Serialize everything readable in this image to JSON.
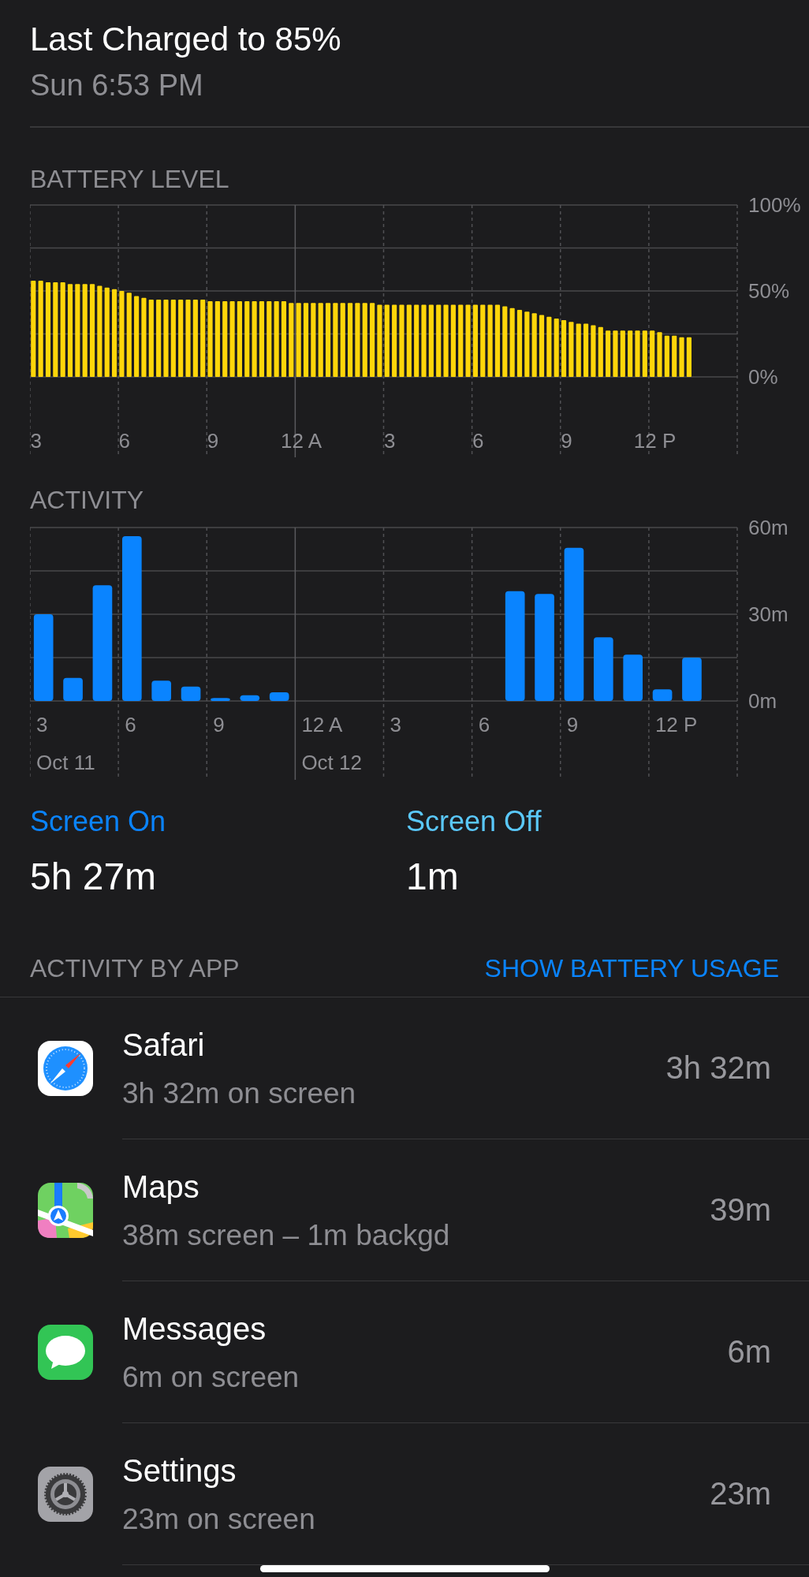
{
  "header": {
    "title": "Last Charged to 85%",
    "subtitle": "Sun 6:53 PM"
  },
  "charts": [
    {
      "chart_data": {
        "type": "bar",
        "title": "BATTERY LEVEL",
        "ylim": [
          0,
          100
        ],
        "grid": true,
        "categories": [
          "3",
          null,
          null,
          null,
          null,
          null,
          null,
          null,
          null,
          null,
          null,
          null,
          "6",
          null,
          null,
          null,
          null,
          null,
          null,
          null,
          null,
          null,
          null,
          null,
          "9",
          null,
          null,
          null,
          null,
          null,
          null,
          null,
          null,
          null,
          null,
          null,
          "12 A",
          null,
          null,
          null,
          null,
          null,
          null,
          null,
          null,
          null,
          null,
          null,
          "3",
          null,
          null,
          null,
          null,
          null,
          null,
          null,
          null,
          null,
          null,
          null,
          "6",
          null,
          null,
          null,
          null,
          null,
          null,
          null,
          null,
          null,
          null,
          null,
          "9",
          null,
          null,
          null,
          null,
          null,
          null,
          null,
          null,
          null,
          null,
          null,
          "12 P",
          null,
          null,
          null,
          null,
          null,
          null,
          null,
          null,
          null,
          null,
          null
        ],
        "values": [
          56,
          56,
          55,
          55,
          55,
          54,
          54,
          54,
          54,
          53,
          52,
          51,
          50,
          49,
          47,
          46,
          45,
          45,
          45,
          45,
          45,
          45,
          45,
          45,
          44,
          44,
          44,
          44,
          44,
          44,
          44,
          44,
          44,
          44,
          44,
          43,
          43,
          43,
          43,
          43,
          43,
          43,
          43,
          43,
          43,
          43,
          43,
          42,
          42,
          42,
          42,
          42,
          42,
          42,
          42,
          42,
          42,
          42,
          42,
          42,
          42,
          42,
          42,
          42,
          41,
          40,
          39,
          38,
          37,
          36,
          35,
          34,
          33,
          32,
          31,
          31,
          30,
          29,
          27,
          27,
          27,
          27,
          27,
          27,
          27,
          26,
          24,
          24,
          23,
          23,
          null,
          null,
          null,
          null,
          null,
          null
        ],
        "yticks": [
          {
            "value": 0,
            "label": "0%"
          },
          {
            "value": 50,
            "label": "50%"
          },
          {
            "value": 100,
            "label": "100%"
          }
        ]
      }
    },
    {
      "chart_data": {
        "type": "bar",
        "title": "ACTIVITY",
        "ylim": [
          0,
          60
        ],
        "grid": true,
        "categories": [
          "3",
          null,
          null,
          "6",
          null,
          null,
          "9",
          null,
          null,
          "12 A",
          null,
          null,
          "3",
          null,
          null,
          "6",
          null,
          null,
          "9",
          null,
          null,
          "12 P",
          null,
          null
        ],
        "values": [
          30,
          8,
          40,
          57,
          7,
          5,
          1,
          2,
          3,
          null,
          null,
          null,
          null,
          null,
          null,
          null,
          38,
          37,
          53,
          22,
          16,
          4,
          15,
          null
        ],
        "yticks": [
          {
            "value": 0,
            "label": "0m"
          },
          {
            "value": 30,
            "label": "30m"
          },
          {
            "value": 60,
            "label": "60m"
          }
        ]
      },
      "dates": [
        "Oct 11",
        "Oct 12"
      ]
    }
  ],
  "screen_times": [
    {
      "label": "Screen On",
      "value": "5h 27m",
      "color": "#0a84ff"
    },
    {
      "label": "Screen Off",
      "value": "1m",
      "color": "#5ac8fa"
    }
  ],
  "apps_section": {
    "heading": "ACTIVITY BY APP",
    "action": "SHOW BATTERY USAGE"
  },
  "apps": [
    {
      "kind": "safari",
      "name": "Safari",
      "detail": "3h 32m on screen",
      "time": "3h 32m"
    },
    {
      "kind": "maps",
      "name": "Maps",
      "detail": "38m screen – 1m backgd",
      "time": "39m"
    },
    {
      "kind": "messages",
      "name": "Messages",
      "detail": "6m on screen",
      "time": "6m"
    },
    {
      "kind": "settings",
      "name": "Settings",
      "detail": "23m on screen",
      "time": "23m"
    }
  ]
}
